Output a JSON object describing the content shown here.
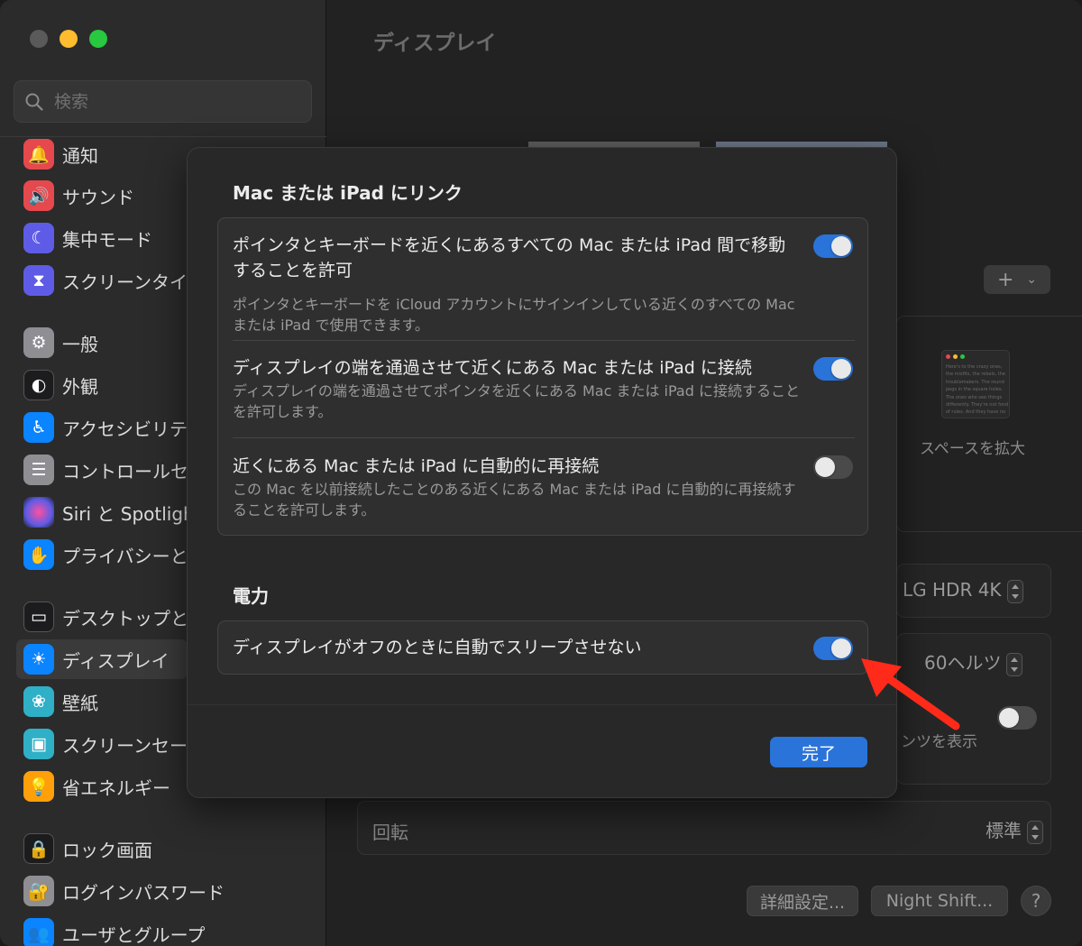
{
  "window": {
    "title": "ディスプレイ"
  },
  "sidebar": {
    "search_placeholder": "検索",
    "items": [
      {
        "label": "通知",
        "icon": "bell-icon",
        "color": "#e5484d"
      },
      {
        "label": "サウンド",
        "icon": "speaker-icon",
        "color": "#e5484d"
      },
      {
        "label": "集中モード",
        "icon": "moon-icon",
        "color": "#5e5ce6"
      },
      {
        "label": "スクリーンタイム",
        "icon": "hourglass-icon",
        "color": "#5e5ce6"
      },
      {
        "label": "一般",
        "icon": "gear-icon",
        "color": "#8e8e93"
      },
      {
        "label": "外観",
        "icon": "appearance-icon",
        "color": "#1c1c1e"
      },
      {
        "label": "アクセシビリティ",
        "icon": "accessibility-icon",
        "color": "#0a84ff"
      },
      {
        "label": "コントロールセンター",
        "icon": "control-center-icon",
        "color": "#8e8e93"
      },
      {
        "label": "Siri と Spotlight",
        "icon": "siri-icon",
        "color": "#5e5ce6"
      },
      {
        "label": "プライバシーとセキュリティ",
        "icon": "hand-icon",
        "color": "#0a84ff"
      },
      {
        "label": "デスクトップとDock",
        "icon": "desktop-icon",
        "color": "#1c1c1e"
      },
      {
        "label": "ディスプレイ",
        "icon": "sun-icon",
        "color": "#0a84ff"
      },
      {
        "label": "壁紙",
        "icon": "flower-icon",
        "color": "#30b0c7"
      },
      {
        "label": "スクリーンセーバ",
        "icon": "screensaver-icon",
        "color": "#30b0c7"
      },
      {
        "label": "省エネルギー",
        "icon": "lightbulb-icon",
        "color": "#ff9f0a"
      },
      {
        "label": "ロック画面",
        "icon": "lock-icon",
        "color": "#1c1c1e"
      },
      {
        "label": "ログインパスワード",
        "icon": "padlock-icon",
        "color": "#8e8e93"
      },
      {
        "label": "ユーザとグループ",
        "icon": "users-icon",
        "color": "#0a84ff"
      }
    ]
  },
  "main": {
    "thumb_text": "Here's to the crazy ones, the misfits, the rebels, the troublemakers. The round pegs in the square holes. The ones who see things differently. They're not fond of rules. And they have no respect for the status quo. You can quote them, disagree with them, glorify or vilify them. About the only thing you can't do is ignore them. Because they change things.",
    "space_label": "スペースを拡大",
    "monitor_value": "LG HDR 4K",
    "refresh_value": "60ヘルツ",
    "hdr_partial_label": "ンツを表示",
    "rotation_label": "回転",
    "rotation_value": "標準",
    "advanced_button": "詳細設定...",
    "night_shift_button": "Night Shift...",
    "help_button": "?"
  },
  "sheet": {
    "link_section_title": "Mac または iPad にリンク",
    "rows": [
      {
        "title": "ポインタとキーボードを近くにあるすべての Mac または iPad 間で移動することを許可",
        "subtitle": "ポインタとキーボードを iCloud アカウントにサインインしている近くのすべての Mac または iPad で使用できます。",
        "enabled": true
      },
      {
        "title": "ディスプレイの端を通過させて近くにある Mac または iPad に接続",
        "subtitle": "ディスプレイの端を通過させてポインタを近くにある Mac または iPad に接続することを許可します。",
        "enabled": true
      },
      {
        "title": "近くにある Mac または iPad に自動的に再接続",
        "subtitle": "この Mac を以前接続したことのある近くにある Mac または iPad に自動的に再接続することを許可します。",
        "enabled": false
      }
    ],
    "power_section_title": "電力",
    "power_row": {
      "title": "ディスプレイがオフのときに自動でスリープさせない",
      "enabled": true
    },
    "done_button": "完了"
  },
  "colors": {
    "accent": "#2a73d8",
    "annotation_arrow": "#ff2a1a"
  }
}
